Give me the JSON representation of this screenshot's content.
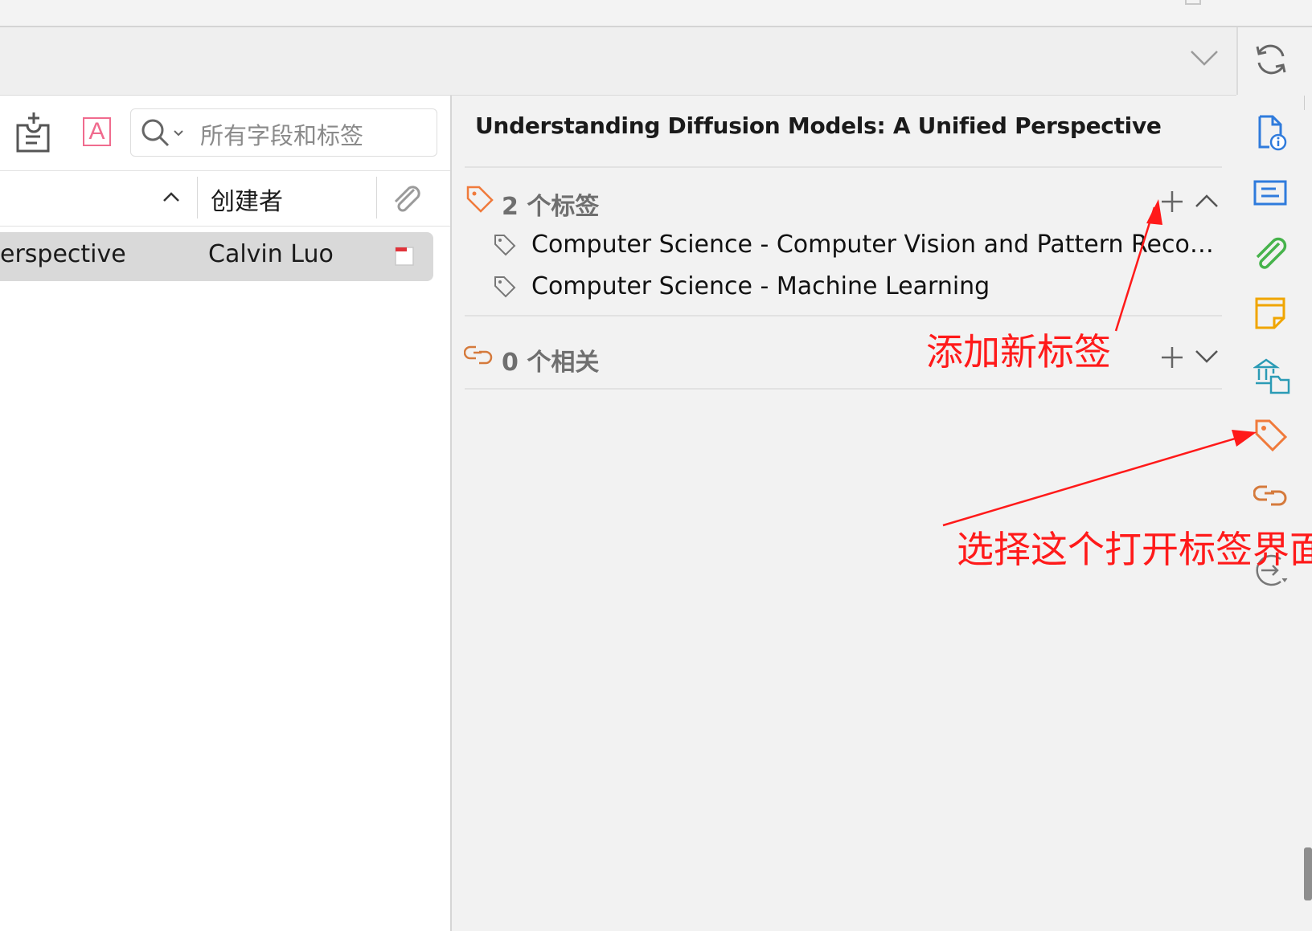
{
  "toolbar": {
    "search_placeholder": "所有字段和标签"
  },
  "items_list": {
    "columns": {
      "creator": "创建者"
    },
    "rows": [
      {
        "title_fragment": "erspective",
        "creator": "Calvin Luo"
      }
    ]
  },
  "item_pane": {
    "title": "Understanding Diffusion Models: A Unified Perspective",
    "tags_section": {
      "count_label": "2 个标签",
      "tags": [
        "Computer Science - Computer Vision and Pattern Reco…",
        "Computer Science - Machine Learning"
      ]
    },
    "related_section": {
      "count_label": "0 个相关"
    }
  },
  "annotations": {
    "add_tag": "添加新标签",
    "open_tags": "选择这个打开标签界面"
  },
  "colors": {
    "tag_orange": "#f07a3b",
    "annotation_red": "#ff1a1a",
    "nav_blue": "#2f7bdc",
    "nav_green": "#46b34b",
    "nav_yellow": "#f0a500",
    "related_brown": "#d57a3c"
  }
}
